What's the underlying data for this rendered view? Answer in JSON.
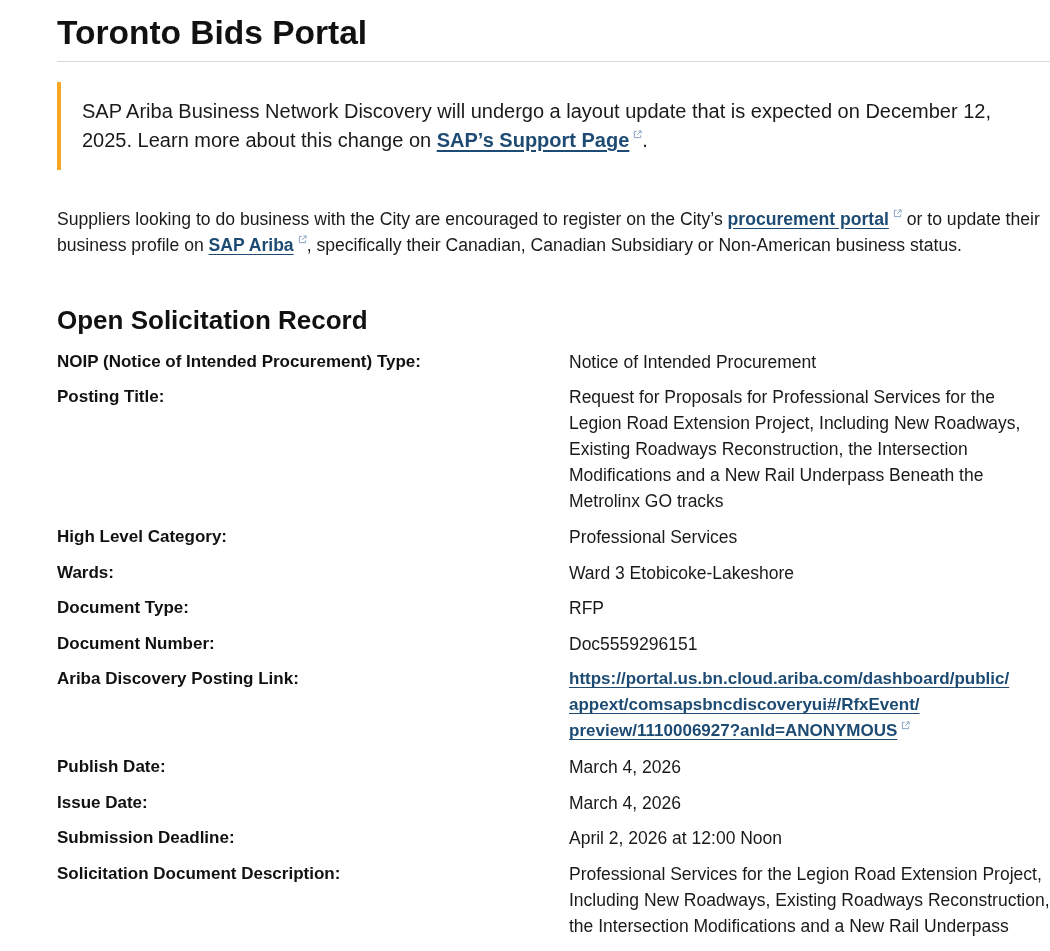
{
  "page": {
    "title": "Toronto Bids Portal"
  },
  "notice": {
    "parts": [
      {
        "kind": "text",
        "text": "SAP Ariba Business Network Discovery will undergo a layout update that is expected on December 12, 2025. Learn more about this change on "
      },
      {
        "kind": "link",
        "text": "SAP’s Support Page"
      },
      {
        "kind": "text",
        "text": "."
      }
    ]
  },
  "intro": {
    "parts": [
      {
        "kind": "text",
        "text": "Suppliers looking to do business with the City are encouraged to register on the City’s "
      },
      {
        "kind": "link",
        "text": "procurement portal"
      },
      {
        "kind": "text",
        "text": " or to update their business profile on "
      },
      {
        "kind": "link",
        "text": "SAP Ariba"
      },
      {
        "kind": "text",
        "text": ", specifically their Canadian, Canadian Subsidiary or Non-American business status."
      }
    ]
  },
  "record": {
    "heading": "Open Solicitation Record",
    "fields": [
      {
        "label": "NOIP (Notice of Intended Procurement) Type:",
        "kind": "text",
        "value": "Notice of Intended Procurement"
      },
      {
        "label": "Posting Title:",
        "kind": "text",
        "value": "Request for Proposals for Professional Services for the Legion Road Extension Project, Including New Roadways, Existing Roadways Reconstruction, the Intersection Modifications and a New Rail Underpass Beneath the Metrolinx GO tracks"
      },
      {
        "label": "High Level Category:",
        "kind": "text",
        "value": "Professional Services"
      },
      {
        "label": "Wards:",
        "kind": "text",
        "value": "Ward 3 Etobicoke-Lakeshore"
      },
      {
        "label": "Document Type:",
        "kind": "text",
        "value": "RFP"
      },
      {
        "label": "Document Number:",
        "kind": "text",
        "value": "Doc5559296151"
      },
      {
        "label": "Ariba Discovery Posting Link:",
        "kind": "link",
        "value": "https://portal.us.bn.cloud.ariba.com/dashboard/public/appext/comsapsbncdiscoveryui#/RfxEvent/preview/1110006927?anId=ANONYMOUS"
      },
      {
        "label": "Publish Date:",
        "kind": "text",
        "value": "March 4, 2026"
      },
      {
        "label": "Issue Date:",
        "kind": "text",
        "value": "March 4, 2026"
      },
      {
        "label": "Submission Deadline:",
        "kind": "text",
        "value": "April 2, 2026 at 12:00 Noon"
      },
      {
        "label": "Solicitation Document Description:",
        "kind": "text",
        "value": "Professional Services for the Legion Road Extension Project, Including New Roadways, Existing Roadways Reconstruction, the Intersection Modifications and a New Rail Underpass"
      }
    ]
  }
}
